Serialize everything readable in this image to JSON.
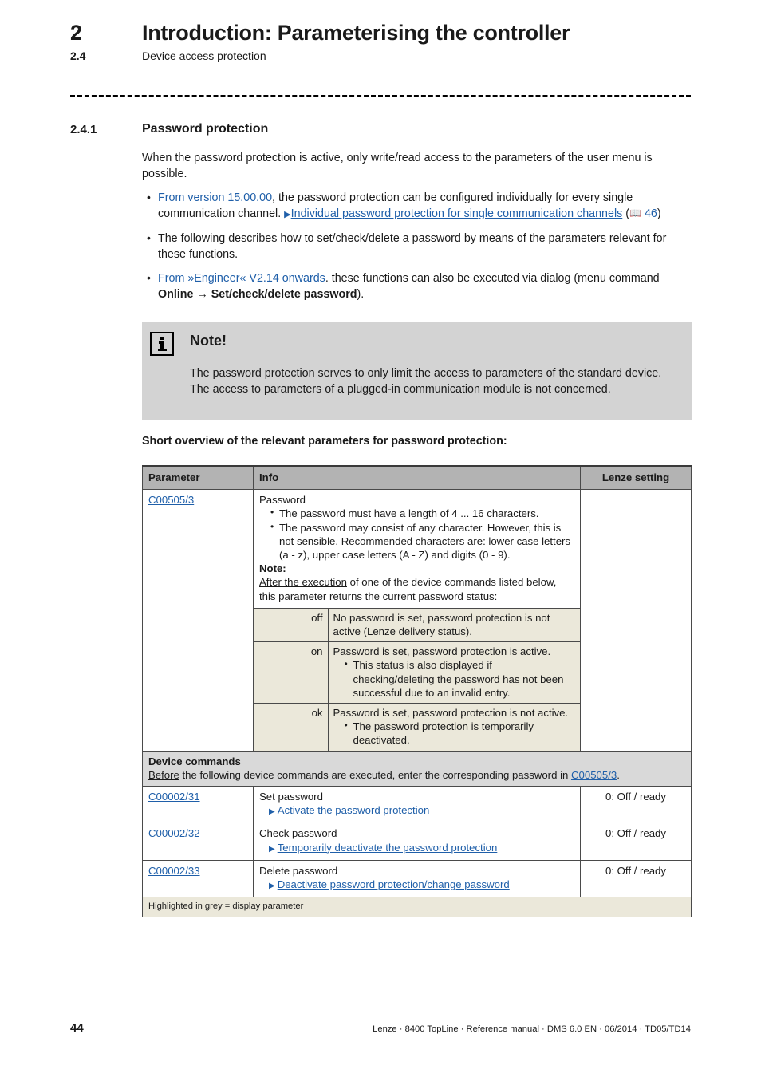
{
  "header": {
    "chapter_number": "2",
    "chapter_title": "Introduction: Parameterising the controller",
    "section_number": "2.4",
    "section_title": "Device access protection"
  },
  "section": {
    "number": "2.4.1",
    "title": "Password protection",
    "intro": "When the password protection is active, only write/read access to the parameters of the user menu is possible.",
    "bullets": [
      {
        "lead": "From version 15.00.00",
        "text": ", the password protection can be configured individually for every single communication channel.",
        "link": "Individual password protection for single communication channels",
        "page_ref": "46"
      },
      {
        "text": "The following describes how to set/check/delete a password by means of the parameters relevant for these functions."
      },
      {
        "lead": "From »Engineer« V2.14 onwards",
        "text": ". these functions can also be executed via dialog (menu command ",
        "bold1": "Online",
        "arrow": "→",
        "bold2": "Set/check/delete password",
        "tail": ")."
      }
    ]
  },
  "note": {
    "icon": "info-icon",
    "title": "Note!",
    "body": "The password protection serves to only limit the access to parameters of the standard device. The access to parameters of a plugged-in communication module is not concerned."
  },
  "table": {
    "caption": "Short overview of the relevant parameters for password protection:",
    "headers": {
      "parameter": "Parameter",
      "info": "Info",
      "lenze_setting": "Lenze setting"
    },
    "password_row": {
      "parameter": "C00505/3",
      "info_title": "Password",
      "info_bullets": [
        "The password must have a length of 4 ... 16 characters.",
        "The password may consist of any character. However, this is not sensible. Recommended characters are: lower case letters (a - z), upper case letters (A - Z) and digits (0 - 9)."
      ],
      "note_label": "Note:",
      "note_underlined": "After the execution",
      "note_rest": " of one of the device commands listed below, this parameter returns the current password status:",
      "status_rows": [
        {
          "key": "off",
          "text": "No password is set, password protection is not active (Lenze delivery status).",
          "sub": []
        },
        {
          "key": "on",
          "text": "Password is set, password protection is active.",
          "sub": [
            "This status is also displayed if checking/deleting the password has not been successful due to an invalid entry."
          ]
        },
        {
          "key": "ok",
          "text": "Password is set, password protection is not active.",
          "sub": [
            "The password protection is temporarily deactivated."
          ]
        }
      ]
    },
    "device_commands": {
      "title": "Device commands",
      "underlined_word": "Before",
      "text_mid": " the following device commands are executed, enter the corresponding password in ",
      "link": "C00505/3",
      "text_end": "."
    },
    "command_rows": [
      {
        "parameter": "C00002/31",
        "info_title": "Set password",
        "info_link": "Activate the password protection",
        "lenze_setting": "0: Off / ready"
      },
      {
        "parameter": "C00002/32",
        "info_title": "Check password",
        "info_link": "Temporarily deactivate the password protection",
        "lenze_setting": "0: Off / ready"
      },
      {
        "parameter": "C00002/33",
        "info_title": "Delete password",
        "info_link": "Deactivate password protection/change password",
        "lenze_setting": "0: Off / ready"
      }
    ],
    "legend": "Highlighted in grey = display parameter"
  },
  "footer": {
    "page_number": "44",
    "meta": "Lenze · 8400 TopLine · Reference manual · DMS 6.0 EN · 06/2014 · TD05/TD14"
  },
  "colors": {
    "link": "#1f5fa9",
    "note_bg": "#d3d3d3",
    "table_header_bg": "#b3b3b3",
    "status_bg": "#ebe8da",
    "devcmd_bg": "#d9d9d9"
  }
}
